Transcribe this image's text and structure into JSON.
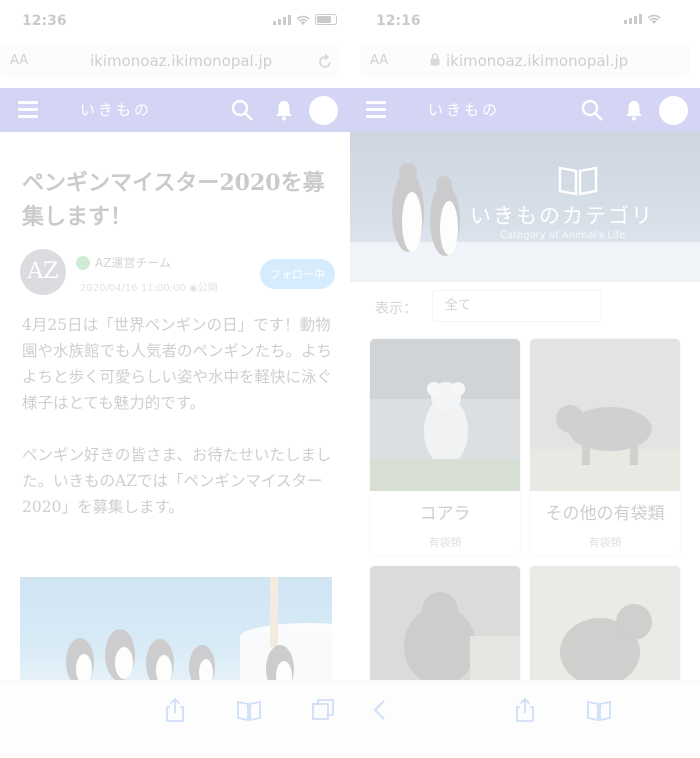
{
  "left": {
    "status": {
      "time": "12:36"
    },
    "browser": {
      "text_size_label": "AA",
      "url": "ikimonoaz.ikimonopal.jp"
    },
    "header": {
      "logo": "いきもの"
    },
    "article": {
      "title": "ペンギンマイスター2020を募集します！",
      "author": {
        "avatar_text": "AZ",
        "name": "AZ運営チーム",
        "date": "2020/04/16 11:00:00 ◉公開"
      },
      "follow_label": "フォロー中",
      "paragraphs": [
        "4月25日は「世界ペンギンの日」です！動物園や水族館でも人気者のペンギンたち。よちよちと歩く可愛らしい姿や水中を軽快に泳ぐ様子はとても魅力的です。",
        "ペンギン好きの皆さま、お待たせいたしました。いきものAZでは「ペンギンマイスター2020」を募集します。"
      ]
    }
  },
  "right": {
    "status": {
      "time": "12:16"
    },
    "browser": {
      "text_size_label": "AA",
      "url": "ikimonoaz.ikimonopal.jp"
    },
    "header": {
      "logo": "いきもの"
    },
    "banner": {
      "title": "いきものカテゴリ",
      "subtitle": "Category of Animal's Life"
    },
    "filter": {
      "label": "表示：",
      "value": "全て"
    },
    "categories": [
      {
        "name": "コアラ",
        "type": "有袋類"
      },
      {
        "name": "その他の有袋類",
        "type": "有袋類"
      },
      {
        "name": "",
        "type": ""
      },
      {
        "name": "",
        "type": ""
      }
    ]
  },
  "colors": {
    "brand": "#3d41cf",
    "follow": "#46a7f2",
    "verified": "#2aa84a"
  },
  "icons": [
    "signal-icon",
    "wifi-icon",
    "battery-icon",
    "lock-icon",
    "reload-icon",
    "menu-icon",
    "search-icon",
    "bell-icon",
    "avatar-icon",
    "book-icon",
    "share-icon",
    "bookmarks-icon",
    "tabs-icon",
    "back-icon"
  ]
}
